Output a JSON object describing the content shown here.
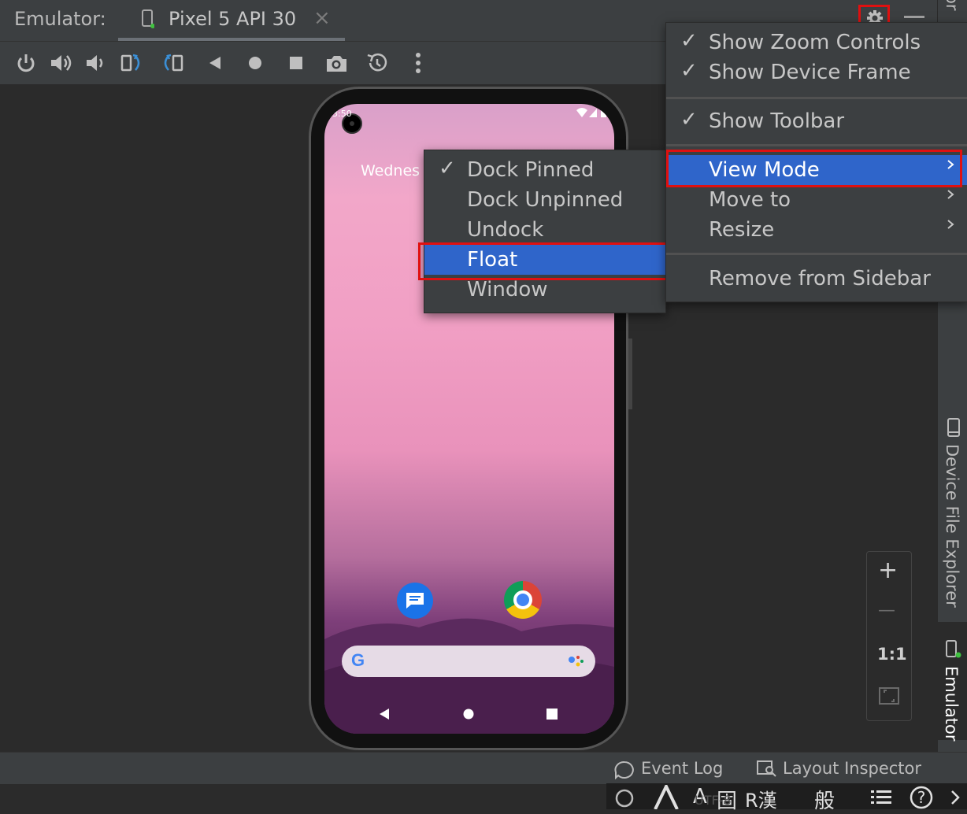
{
  "header": {
    "title": "Emulator:",
    "tab_label": "Pixel 5 API 30",
    "tab_close": "×"
  },
  "toolbar": {
    "icons": [
      "power-icon",
      "volume-up-icon",
      "volume-down-icon",
      "rotate-left-icon",
      "rotate-right-icon",
      "back-icon",
      "home-icon",
      "overview-icon",
      "screenshot-icon",
      "snapshot-icon",
      "more-icon"
    ]
  },
  "phone": {
    "status_time": "3:50",
    "date_text": "Wednes"
  },
  "main_menu": {
    "items": [
      {
        "label": "Show Zoom Controls",
        "checked": true
      },
      {
        "label": "Show Device Frame",
        "checked": true
      },
      {
        "label": "Show Toolbar",
        "checked": true
      },
      {
        "label": "View Mode",
        "highlighted": true,
        "submenu": true
      },
      {
        "label": "Move to",
        "submenu": true
      },
      {
        "label": "Resize",
        "submenu": true
      },
      {
        "label": "Remove from Sidebar"
      }
    ]
  },
  "view_mode_menu": {
    "items": [
      {
        "label": "Dock Pinned",
        "checked": true
      },
      {
        "label": "Dock Unpinned"
      },
      {
        "label": "Undock"
      },
      {
        "label": "Float",
        "highlighted": true
      },
      {
        "label": "Window"
      }
    ]
  },
  "sidebar": {
    "top_label": "or",
    "device_file_explorer": "Device File Explorer",
    "emulator": "Emulator"
  },
  "zoom_controls": {
    "zoom_in": "+",
    "zoom_out": "—",
    "actual_size": "1:1"
  },
  "status_bar": {
    "event_log": "Event Log",
    "layout_inspector": "Layout Inspector"
  },
  "ime_bar": {
    "items": [
      "A",
      "固",
      "R漢",
      "般",
      "UTF-8"
    ]
  },
  "colors": {
    "selection": "#2f65ca",
    "highlight_box": "#e01010",
    "panel": "#3c3f41",
    "background": "#2b2b2b"
  }
}
